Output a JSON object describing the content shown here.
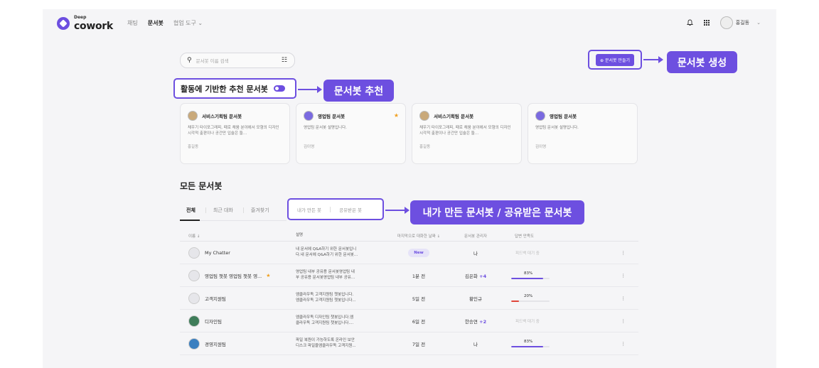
{
  "app": {
    "logo_small": "Deep",
    "logo_big": "cowork"
  },
  "nav": {
    "chat": "채팅",
    "docbot": "문서봇",
    "tools": "협업 도구 ⌄"
  },
  "topbar": {
    "user": "홍길동",
    "user_chevron": "⌄"
  },
  "search": {
    "placeholder": "문서봇 이름 검색"
  },
  "create_button": "⊕ 문서봇 만들기",
  "callouts": {
    "create": "문서봇 생성",
    "recommend": "문서봇 추천",
    "tabs": "내가 만든 문서봇 / 공유받은 문서봇"
  },
  "recommend_label": "활동에 기반한 추천 문서봇",
  "cards": [
    {
      "title": "서비스기획팀 문서봇",
      "desc": "채우기 타이포그래피, 때로 채움 분야에서 모형의 디자인 시각적 출판이나 공간만 입술은 들...",
      "owner": "홍길동",
      "starred": false
    },
    {
      "title": "영업팀 문서봇",
      "desc": "영업팀 문서봇 설명입니다.",
      "owner": "김이영",
      "starred": true
    },
    {
      "title": "서비스기획팀 문서봇",
      "desc": "채우기 타이포그래피, 때로 채움 분야에서 모형의 디자인 시각적 출판이나 공간만 입술은 들...",
      "owner": "홍길동",
      "starred": false
    },
    {
      "title": "영업팀 문서봇",
      "desc": "영업팀 문서봇 설명입니다.",
      "owner": "김이영",
      "starred": false
    }
  ],
  "section_title": "모든 문서봇",
  "tabs": {
    "all": "전체",
    "recent": "최근 대화",
    "fav": "즐겨찾기",
    "mine": "내가 만든 봇",
    "shared": "공유받은 봇"
  },
  "table": {
    "headers": {
      "name": "이름 ↓",
      "desc": "설명",
      "last": "마지막으로 대화한 날짜 ↓",
      "manager": "문서봇 관리자",
      "sat": "답변 만족도"
    },
    "rows": [
      {
        "name": "My Chatter",
        "desc1": "내 문서에 Q&A하기 위한 문서봇입니",
        "desc2": "다.내 문서에 Q&A하기 위한 문서봇...",
        "last": "New",
        "is_new": true,
        "manager": "나",
        "plus": "",
        "sat_text": "피드백 대기 중",
        "sat_pct": null,
        "bar_color": "#6d4fe0",
        "avatar": "#e6e6ea",
        "starred": false,
        "menu": "⋮"
      },
      {
        "name": "영업팀 챗봇 영업팀 챗봇 영...",
        "desc1": "영업팀 내부 공유용 문서봇영업팀 내",
        "desc2": "부 공유용 문서봇영업팀 내부 공유...",
        "last": "1분 전",
        "is_new": false,
        "manager": "김은화",
        "plus": "+4",
        "sat_text": "83%",
        "sat_pct": 83,
        "bar_color": "#6d4fe0",
        "avatar": "#e6e6ea",
        "starred": true,
        "menu": "⋮"
      },
      {
        "name": "고객지원팀",
        "desc1": "엠클라우독 고객지원팀 챗봇입니다.",
        "desc2": "엠클라우독 고객지원팀 챗봇입니다...",
        "last": "5일 전",
        "is_new": false,
        "manager": "황인규",
        "plus": "",
        "sat_text": "20%",
        "sat_pct": 20,
        "bar_color": "#e0453a",
        "avatar": "#e6e6ea",
        "starred": false,
        "menu": "⋮"
      },
      {
        "name": "디자인팀",
        "desc1": "엠클라우독 디자인팀 챗봇입니다.엠",
        "desc2": "클라우독 고객지원팀 챗봇입니다....",
        "last": "6일 전",
        "is_new": false,
        "manager": "한승연",
        "plus": "+2",
        "sat_text": "피드백 대기 중",
        "sat_pct": null,
        "bar_color": "#6d4fe0",
        "avatar": "#3f7d5a",
        "starred": false,
        "menu": "⋮"
      },
      {
        "name": "경영지원팀",
        "desc1": "파일 복원이 가능하도록 온라인 보안",
        "desc2": "디스크 파일을엠클라우독 고객지원...",
        "last": "7일 전",
        "is_new": false,
        "manager": "나",
        "plus": "",
        "sat_text": "83%",
        "sat_pct": 83,
        "bar_color": "#6d4fe0",
        "avatar": "#3a7fc0",
        "starred": false,
        "menu": "⋮"
      }
    ]
  }
}
